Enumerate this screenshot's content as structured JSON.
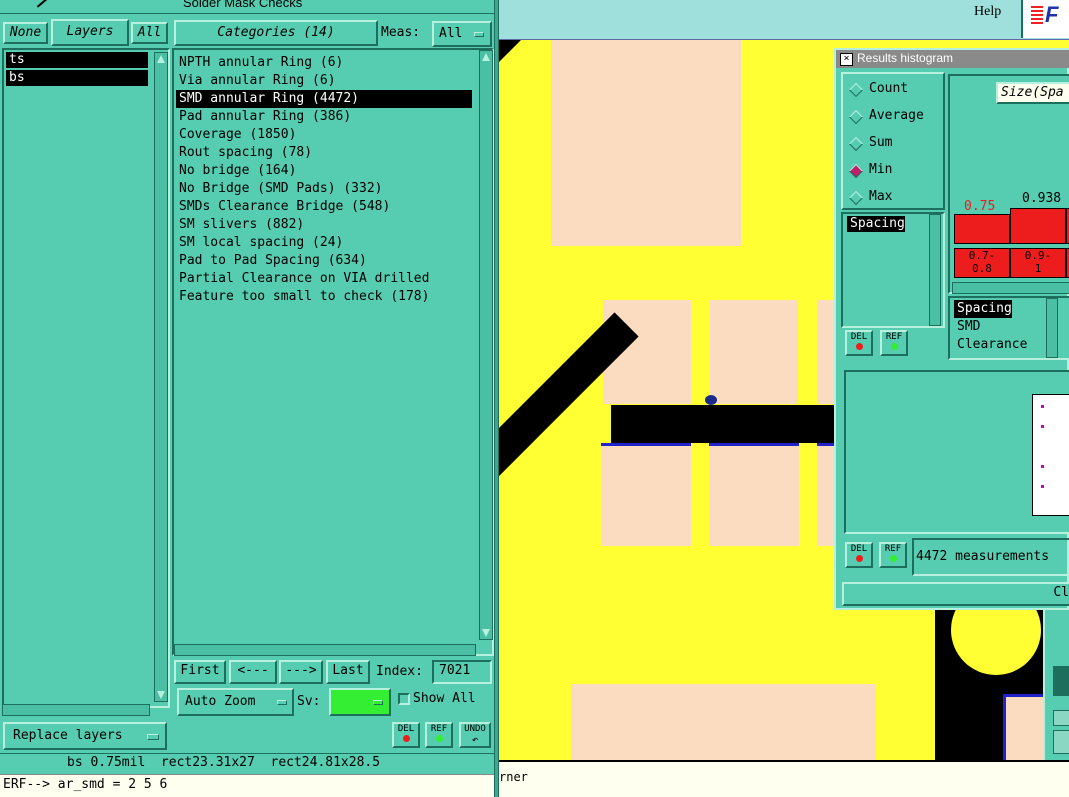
{
  "window_title": "Solder Mask Checks",
  "layers_panel": {
    "none_label": "None",
    "layers_label": "Layers",
    "all_label": "All",
    "items": [
      {
        "label": "ts"
      },
      {
        "label": "bs"
      }
    ],
    "replace_layers_label": "Replace layers"
  },
  "categories_panel": {
    "header": "Categories (14)",
    "meas_label": "Meas:",
    "meas_value": "All",
    "items": [
      {
        "label": "NPTH annular Ring (6)"
      },
      {
        "label": "Via annular Ring (6)"
      },
      {
        "label": "SMD annular Ring (4472)"
      },
      {
        "label": "Pad annular Ring (386)"
      },
      {
        "label": "Coverage (1850)"
      },
      {
        "label": "Rout spacing (78)"
      },
      {
        "label": "No bridge (164)"
      },
      {
        "label": "No Bridge (SMD Pads) (332)"
      },
      {
        "label": "SMDs Clearance Bridge (548)"
      },
      {
        "label": "SM slivers (882)"
      },
      {
        "label": "SM local spacing (24)"
      },
      {
        "label": "Pad to Pad Spacing (634)"
      },
      {
        "label": "Partial Clearance on VIA drilled"
      },
      {
        "label": "Feature too small to check (178)"
      }
    ],
    "selected_index": 2,
    "first_label": "First",
    "prev_label": "<---",
    "next_label": "--->",
    "last_label": "Last",
    "index_label": "Index:",
    "index_value": "7021",
    "auto_zoom_label": "Auto Zoom",
    "sv_label": "Sv:",
    "show_all_label": "Show All",
    "del_label": "DEL",
    "ref_label": "REF",
    "undo_label": "UNDO"
  },
  "status": {
    "measure_text": "bs 0.75mil  rect23.31x27  rect24.81x28.5",
    "command_text": "ERF--> ar_smd = 2 5 6",
    "canvas_status": "rner"
  },
  "top_bar": {
    "help_label": "Help",
    "logo_text": "F"
  },
  "histogram": {
    "title": "Results histogram",
    "modes": [
      {
        "label": "Count"
      },
      {
        "label": "Average"
      },
      {
        "label": "Sum"
      },
      {
        "label": "Min"
      },
      {
        "label": "Max"
      }
    ],
    "selected_mode": 3,
    "size_header": "Size(Spa",
    "bar_values": [
      {
        "label": "0.75"
      },
      {
        "label": "0.938"
      }
    ],
    "ranges": [
      {
        "label": "0.7-\n0.8"
      },
      {
        "label": "0.9-\n1"
      }
    ],
    "list1": [
      {
        "label": "Spacing"
      }
    ],
    "list2": [
      {
        "label": "Spacing"
      },
      {
        "label": "SMD"
      },
      {
        "label": "Clearance"
      }
    ],
    "del_label": "DEL",
    "ref_label": "REF",
    "measurements_text": "4472 measurements",
    "close_label": "Cl"
  },
  "colors": {
    "panel": "#56ccb0",
    "canvas_bg": "#ffff33",
    "pad": "#fcdcc0",
    "trace": "#000000",
    "bar_red": "#ee1d1d",
    "sv_green": "#33ee33"
  }
}
